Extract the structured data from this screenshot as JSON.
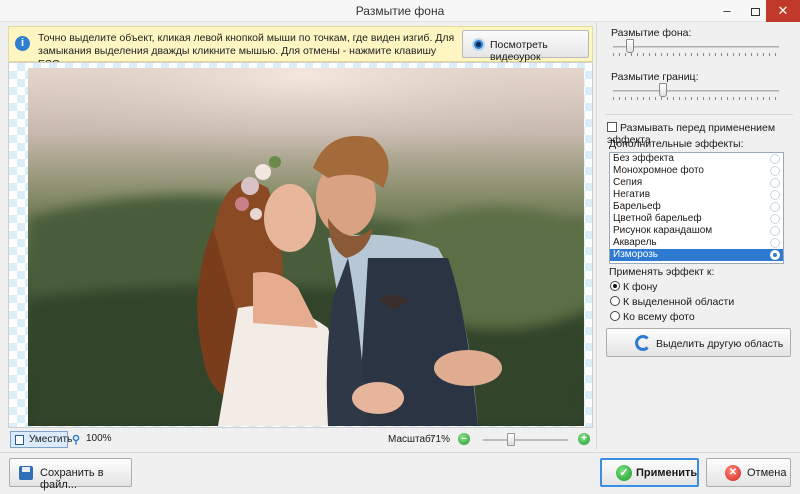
{
  "window": {
    "title": "Размытие фона",
    "minimize": "–",
    "close": "✕"
  },
  "hint": {
    "icon": "i",
    "text": "Точно выделите объект, кликая левой кнопкой мыши по точкам, где виден изгиб. Для замыкания выделения дважды кликните мышью. Для отмены - нажмите клавишу ESC.",
    "video_button": "Посмотреть видеоурок"
  },
  "status": {
    "fit_label": "Уместить",
    "actual_size_label": "100%",
    "scale_label": "Масштаб:",
    "scale_value": "71%",
    "zoom_level": 0.33
  },
  "settings": {
    "background_blur_label": "Размытие фона:",
    "background_blur_level": 0.1,
    "edge_blur_label": "Размытие границ:",
    "edge_blur_level": 0.3,
    "blur_before_effect_label": "Размывать перед применением эффекта",
    "blur_before_effect_checked": false,
    "extra_effects_label": "Дополнительные эффекты:",
    "effects": [
      "Без эффекта",
      "Монохромное фото",
      "Сепия",
      "Негатив",
      "Барельеф",
      "Цветной барельеф",
      "Рисунок карандашом",
      "Акварель",
      "Изморозь"
    ],
    "selected_effect": "Изморозь",
    "apply_to_label": "Применять эффект к:",
    "apply_to_options": [
      "К фону",
      "К выделенной области",
      "Ко всему фото"
    ],
    "apply_to_selected": "К фону",
    "select_area_button": "Выделить другую область"
  },
  "footer": {
    "save_button": "Сохранить в файл...",
    "apply_button": "Применить",
    "cancel_button": "Отмена"
  },
  "colors": {
    "hint_background": "#fdf6c3",
    "selection": "#2f7ad1",
    "close_button": "#c0392b"
  }
}
